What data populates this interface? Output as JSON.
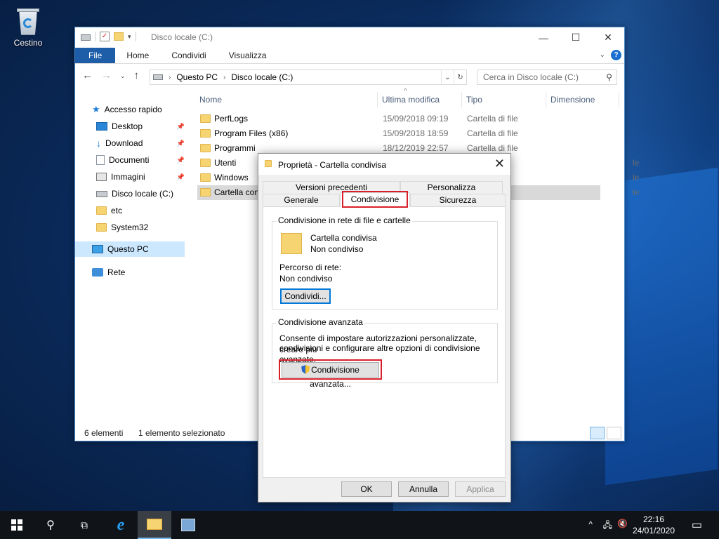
{
  "desktop": {
    "recycle_bin_label": "Cestino"
  },
  "explorer": {
    "title": "Disco locale (C:)",
    "ribbon_tabs": [
      "File",
      "Home",
      "Condividi",
      "Visualizza"
    ],
    "breadcrumb": [
      "Questo PC",
      "Disco locale (C:)"
    ],
    "search_placeholder": "Cerca in Disco locale (C:)",
    "columns": {
      "name": "Nome",
      "modified": "Ultima modifica",
      "type": "Tipo",
      "size": "Dimensione"
    },
    "nav": {
      "quick_access": "Accesso rapido",
      "items": [
        "Desktop",
        "Download",
        "Documenti",
        "Immagini",
        "Disco locale (C:)",
        "etc",
        "System32"
      ],
      "this_pc": "Questo PC",
      "network": "Rete"
    },
    "files": [
      {
        "name": "PerfLogs",
        "modified": "15/09/2018 09:19",
        "type": "Cartella di file"
      },
      {
        "name": "Program Files (x86)",
        "modified": "15/09/2018 18:59",
        "type": "Cartella di file"
      },
      {
        "name": "Programmi",
        "modified": "18/12/2019 22:57",
        "type": "Cartella di file"
      },
      {
        "name": "Utenti",
        "modified": "",
        "type": "le"
      },
      {
        "name": "Windows",
        "modified": "",
        "type": "le"
      },
      {
        "name": "Cartella con",
        "modified": "",
        "type": "le"
      }
    ],
    "status": {
      "count": "6 elementi",
      "selection": "1 elemento selezionato"
    }
  },
  "dialog": {
    "title": "Proprietà - Cartella condivisa",
    "tabs_back": [
      "Versioni precedenti",
      "Personalizza"
    ],
    "tabs_front": [
      "Generale",
      "Condivisione",
      "Sicurezza"
    ],
    "network_group": {
      "title": "Condivisione in rete di file e cartelle",
      "folder_name": "Cartella condivisa",
      "folder_state": "Non condiviso",
      "path_label": "Percorso di rete:",
      "path_value": "Non condiviso",
      "share_button": "Condividi..."
    },
    "advanced_group": {
      "title": "Condivisione avanzata",
      "description_line1": "Consente di impostare autorizzazioni personalizzate, creare più",
      "description_line2": "condivisioni e configurare altre opzioni di condivisione avanzate.",
      "button": "Condivisione avanzata..."
    },
    "buttons": {
      "ok": "OK",
      "cancel": "Annulla",
      "apply": "Applica"
    }
  },
  "taskbar": {
    "time": "22:16",
    "date": "24/01/2020"
  },
  "colors": {
    "accent": "#0078d7",
    "file_tab": "#1e5ea8",
    "highlight": "#d8202a"
  }
}
